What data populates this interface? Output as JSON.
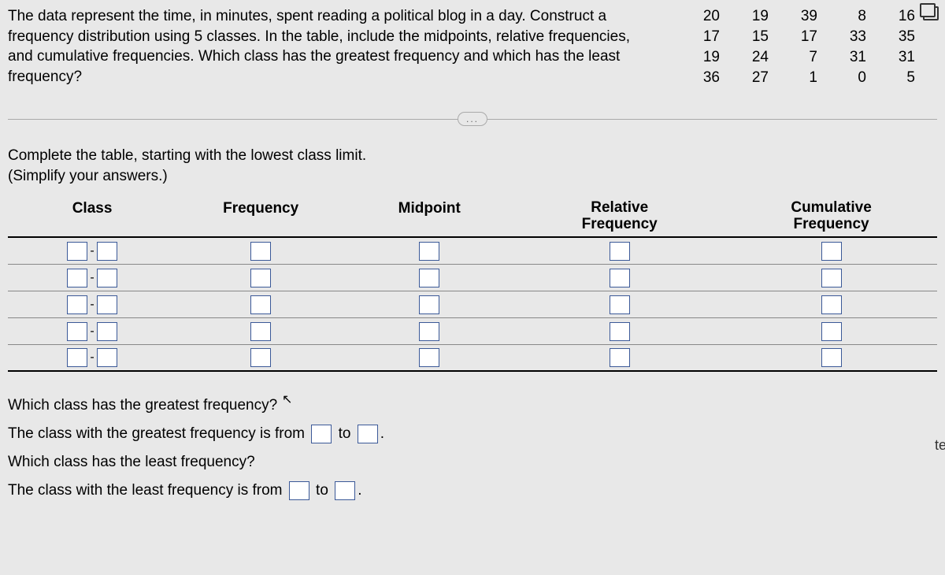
{
  "problem": {
    "text": "The data represent the time, in minutes, spent reading a political blog in a day. Construct a frequency distribution using 5 classes. In the table, include the midpoints, relative frequencies, and cumulative frequencies. Which class has the greatest frequency and which has the least frequency?"
  },
  "data_values": [
    [
      "20",
      "19",
      "39",
      "8",
      "16"
    ],
    [
      "17",
      "15",
      "17",
      "33",
      "35"
    ],
    [
      "19",
      "24",
      "7",
      "31",
      "31"
    ],
    [
      "36",
      "27",
      "1",
      "0",
      "5"
    ]
  ],
  "ellipsis": "...",
  "instructions": {
    "line1": "Complete the table, starting with the lowest class limit.",
    "line2": "(Simplify your answers.)"
  },
  "table": {
    "headers": {
      "class": "Class",
      "frequency": "Frequency",
      "midpoint": "Midpoint",
      "relative_frequency_line1": "Relative",
      "relative_frequency_line2": "Frequency",
      "cumulative_frequency_line1": "Cumulative",
      "cumulative_frequency_line2": "Frequency"
    },
    "class_separator": "-"
  },
  "questions": {
    "q1": "Which class has the greatest frequency?",
    "a1_prefix": "The class with the greatest frequency is from",
    "to": "to",
    "a1_suffix": ".",
    "q2": "Which class has the least frequency?",
    "a2_prefix": "The class with the least frequency is from",
    "a2_suffix": "."
  },
  "edge_fragment": "te"
}
